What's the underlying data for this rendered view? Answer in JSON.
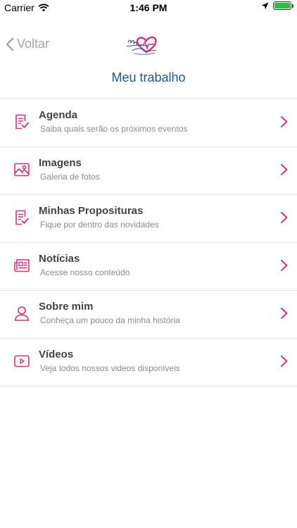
{
  "status_bar": {
    "carrier": "Carrier",
    "time": "1:46 PM"
  },
  "nav": {
    "back_label": "Voltar"
  },
  "page_title": "Meu trabalho",
  "accent_color": "#d6317e",
  "title_color": "#1f5a86",
  "menu_items": [
    {
      "title": "Agenda",
      "subtitle": "Saiba quais serão os próximos eventos",
      "icon": "document-check-icon"
    },
    {
      "title": "Imagens",
      "subtitle": "Galeria de fotos",
      "icon": "image-icon"
    },
    {
      "title": "Minhas Proposituras",
      "subtitle": "Fique por dentro das novidades",
      "icon": "document-check-icon"
    },
    {
      "title": "Notícias",
      "subtitle": "Acesse nosso conteúdo",
      "icon": "newspaper-icon"
    },
    {
      "title": "Sobre mim",
      "subtitle": "Conheça um pouco da minha história",
      "icon": "user-icon"
    },
    {
      "title": "Vídeos",
      "subtitle": "Veja todos nossos videos disponíveis",
      "icon": "video-icon"
    }
  ]
}
